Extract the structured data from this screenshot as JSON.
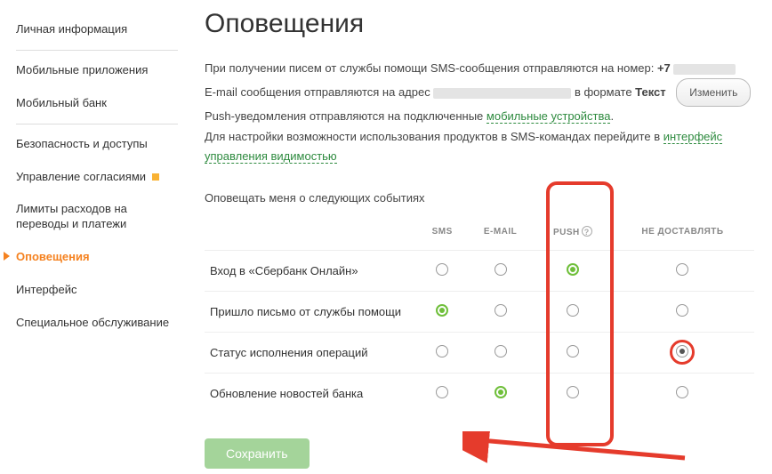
{
  "sidebar": {
    "items": [
      {
        "label": "Личная информация"
      },
      {
        "label": "Мобильные приложения"
      },
      {
        "label": "Мобильный банк"
      },
      {
        "label": "Безопасность и доступы"
      },
      {
        "label": "Управление согласиями"
      },
      {
        "label": "Лимиты расходов на переводы и платежи"
      },
      {
        "label": "Оповещения"
      },
      {
        "label": "Интерфейс"
      },
      {
        "label": "Специальное обслуживание"
      }
    ]
  },
  "page": {
    "title": "Оповещения",
    "intro": {
      "line1a": "При получении писем от службы помощи SMS-сообщения отправляются на номер: ",
      "phonePrefix": "+7",
      "line2a": "E-mail сообщения отправляются на адрес ",
      "line2b": " в формате ",
      "formatWord": "Текст",
      "changeBtn": "Изменить",
      "line3a": "Push-уведомления отправляются на подключенные ",
      "link3": "мобильные устройства",
      "line4a": "Для настройки возможности использования продуктов в SMS-командах перейдите в ",
      "link4": "интерфейс управления видимостью"
    },
    "sectionLabel": "Оповещать меня о следующих событиях",
    "columns": {
      "sms": "SMS",
      "email": "E-MAIL",
      "push": "PUSH",
      "none": "НЕ ДОСТАВЛЯТЬ"
    },
    "rows": [
      {
        "label": "Вход в «Сбербанк Онлайн»",
        "selected": "push"
      },
      {
        "label": "Пришло письмо от службы помощи",
        "selected": "sms"
      },
      {
        "label": "Статус исполнения операций",
        "selected": "none"
      },
      {
        "label": "Обновление новостей банка",
        "selected": "email"
      }
    ],
    "saveBtn": "Сохранить",
    "helpGlyph": "?"
  }
}
